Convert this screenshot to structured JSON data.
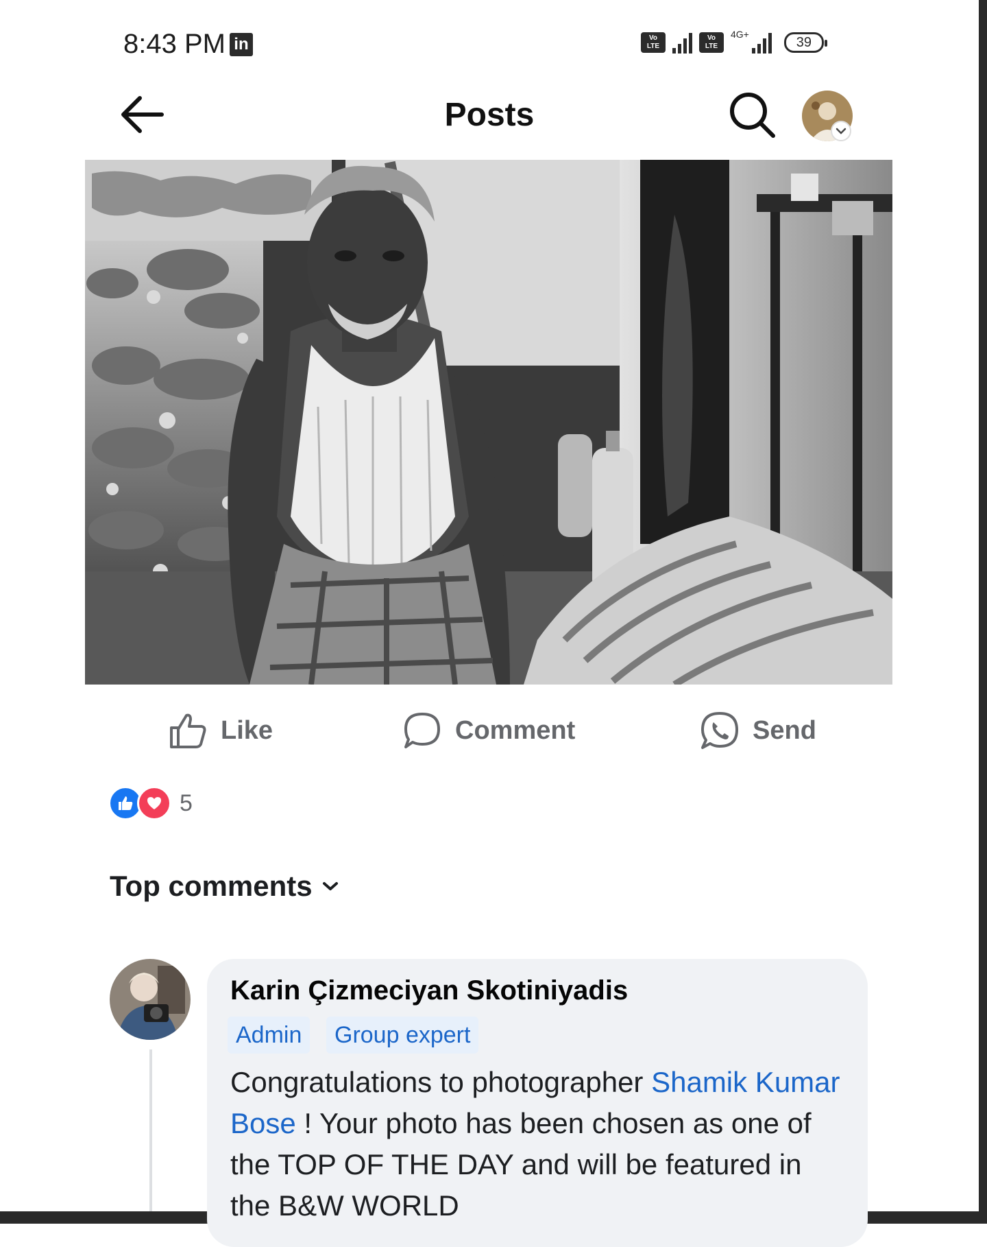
{
  "status_bar": {
    "time": "8:43 PM",
    "app_icon": "linkedin-icon",
    "volte_label": "Vo LTE",
    "network_label": "4G+",
    "battery": "39"
  },
  "header": {
    "title": "Posts",
    "back_icon": "arrow-left-icon",
    "search_icon": "search-icon"
  },
  "post": {
    "actions": [
      {
        "label": "Like",
        "icon": "thumbs-up-icon"
      },
      {
        "label": "Comment",
        "icon": "comment-icon"
      },
      {
        "label": "Send",
        "icon": "whatsapp-icon"
      }
    ],
    "reactions": {
      "types": [
        "like",
        "love"
      ],
      "count": "5",
      "colors": {
        "like": "#1877f2",
        "love": "#f33e58"
      }
    }
  },
  "comments": {
    "sort_label": "Top comments",
    "items": [
      {
        "author": "Karin Çizmeciyan Skotiniyadis",
        "badges": [
          "Admin",
          "Group expert"
        ],
        "text_before": "Congratulations to photographer ",
        "mention": "Shamik Kumar Bose",
        "text_after": " ! Your photo has been chosen as one of the TOP OF THE DAY and will be featured in the B&W WORLD"
      }
    ]
  },
  "colors": {
    "link": "#1b66c9",
    "muted": "#65676b",
    "bubble": "#f0f2f5"
  }
}
